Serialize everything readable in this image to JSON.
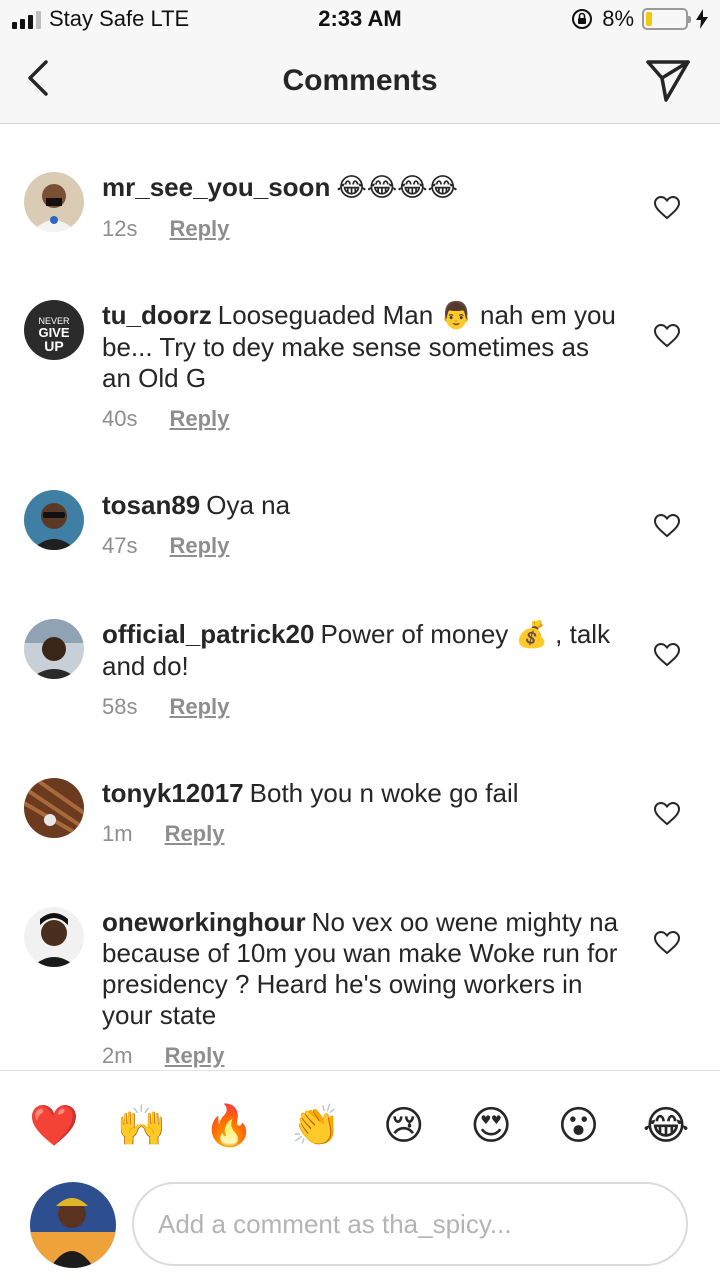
{
  "status_bar": {
    "carrier": "Stay Safe  LTE",
    "time": "2:33 AM",
    "battery_pct": "8%",
    "battery_level": 0.08,
    "icons": [
      "signal-icon",
      "orientation-lock-icon",
      "battery-icon",
      "charging-bolt-icon"
    ]
  },
  "nav": {
    "title": "Comments",
    "back_icon": "chevron-left-icon",
    "send_icon": "paper-plane-icon"
  },
  "comments": [
    {
      "username": "mr_see_you_soon",
      "text": "",
      "emoji": "😂😂😂😂",
      "time": "12s",
      "reply": "Reply"
    },
    {
      "username": "tu_doorz",
      "text": "Looseguaded Man",
      "emoji": "👨",
      "text2": "nah em you be... Try to dey make sense sometimes as an Old G",
      "time": "40s",
      "reply": "Reply"
    },
    {
      "username": "tosan89",
      "text": "Oya na",
      "time": "47s",
      "reply": "Reply"
    },
    {
      "username": "official_patrick20",
      "text": "Power of money",
      "emoji": "💰",
      "text2": ", talk and do!",
      "time": "58s",
      "reply": "Reply"
    },
    {
      "username": "tonyk12017",
      "text": "Both you n woke go fail",
      "time": "1m",
      "reply": "Reply"
    },
    {
      "username": "oneworkinghour",
      "text": "No vex oo wene mighty na because of 10m you wan make Woke run for presidency ?  Heard he's owing workers in your state",
      "time": "2m",
      "reply": "Reply"
    }
  ],
  "emoji_bar": [
    "❤️",
    "🙌",
    "🔥",
    "👏",
    "😢",
    "😍",
    "😮",
    "😂"
  ],
  "composer": {
    "placeholder": "Add a comment as tha_spicy..."
  },
  "colors": {
    "text": "#262626",
    "muted": "#8e8e8e",
    "bar_bg": "#f7f7f7",
    "battery_low": "#f2c811"
  }
}
